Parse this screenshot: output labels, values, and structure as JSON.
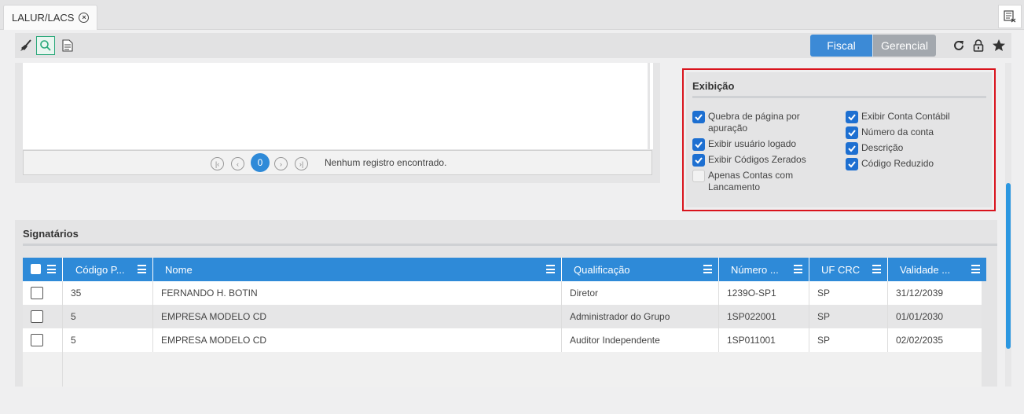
{
  "tabs": [
    {
      "label": "LALUR/LACS"
    }
  ],
  "toolbar": {
    "segment": {
      "fiscal": "Fiscal",
      "gerencial": "Gerencial"
    }
  },
  "pager": {
    "current_page": "0",
    "message": "Nenhum registro encontrado."
  },
  "exibicao": {
    "title": "Exibição",
    "left": [
      {
        "label": "Quebra de página por apuração",
        "checked": true
      },
      {
        "label": "Exibir usuário logado",
        "checked": true
      },
      {
        "label": "Exibir Códigos Zerados",
        "checked": true
      },
      {
        "label": "Apenas Contas com Lancamento",
        "checked": false
      }
    ],
    "right": [
      {
        "label": "Exibir Conta Contábil",
        "checked": true
      },
      {
        "label": "Número da conta",
        "checked": true
      },
      {
        "label": "Descrição",
        "checked": true
      },
      {
        "label": "Código Reduzido",
        "checked": true
      }
    ]
  },
  "signatarios": {
    "title": "Signatários",
    "columns": [
      "Código P...",
      "Nome",
      "Qualificação",
      "Número ...",
      "UF CRC",
      "Validade ..."
    ],
    "rows": [
      {
        "codigo": "35",
        "nome": "FERNANDO H. BOTIN",
        "qualificacao": "Diretor",
        "numero": "1239O-SP1",
        "uf": "SP",
        "validade": "31/12/2039"
      },
      {
        "codigo": "5",
        "nome": "EMPRESA MODELO CD",
        "qualificacao": "Administrador do Grupo",
        "numero": "1SP022001",
        "uf": "SP",
        "validade": "01/01/2030"
      },
      {
        "codigo": "5",
        "nome": "EMPRESA MODELO CD",
        "qualificacao": "Auditor Independente",
        "numero": "1SP011001",
        "uf": "SP",
        "validade": "02/02/2035"
      }
    ]
  },
  "colors": {
    "accent": "#2e8ad8",
    "checkbox": "#1d6fd1",
    "highlight_border": "#d9141d",
    "scroll_thumb": "#2c97e0"
  }
}
